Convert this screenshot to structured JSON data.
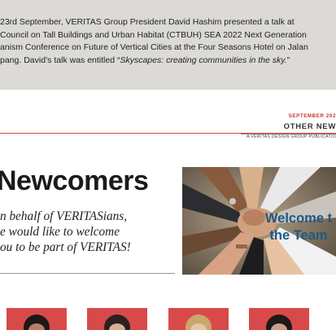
{
  "article": {
    "lines": [
      "23rd September, VERITAS Group President David Hashim presented a talk at",
      "Council on Tall Buildings and Urban Habitat (CTBUH) SEA 2022 Next Generation",
      "anism Conference on Future of Vertical Cities at the Four Seasons Hotel on Jalan",
      "pang. David’s talk was entitled “"
    ],
    "talk_title": "Skyscapes: creating communities in the sky.",
    "closing_quote": "”"
  },
  "masthead": {
    "date": "SEPTEMBER 202",
    "title": "OTHER NEW",
    "subtitle": "A VERITAS DESIGN GROUP PUBLICATIO"
  },
  "section": {
    "heading": "Newcomers",
    "intro_lines": [
      "n behalf of VERITASians,",
      "e would like to welcome",
      "ou to be part of VERITAS!"
    ],
    "photo_caption_lines": [
      "Welcome t",
      "the Team"
    ]
  },
  "colors": {
    "accent_red": "#c8302c",
    "caption_blue": "#1a5a86",
    "portrait_bg": "#d84a49"
  }
}
